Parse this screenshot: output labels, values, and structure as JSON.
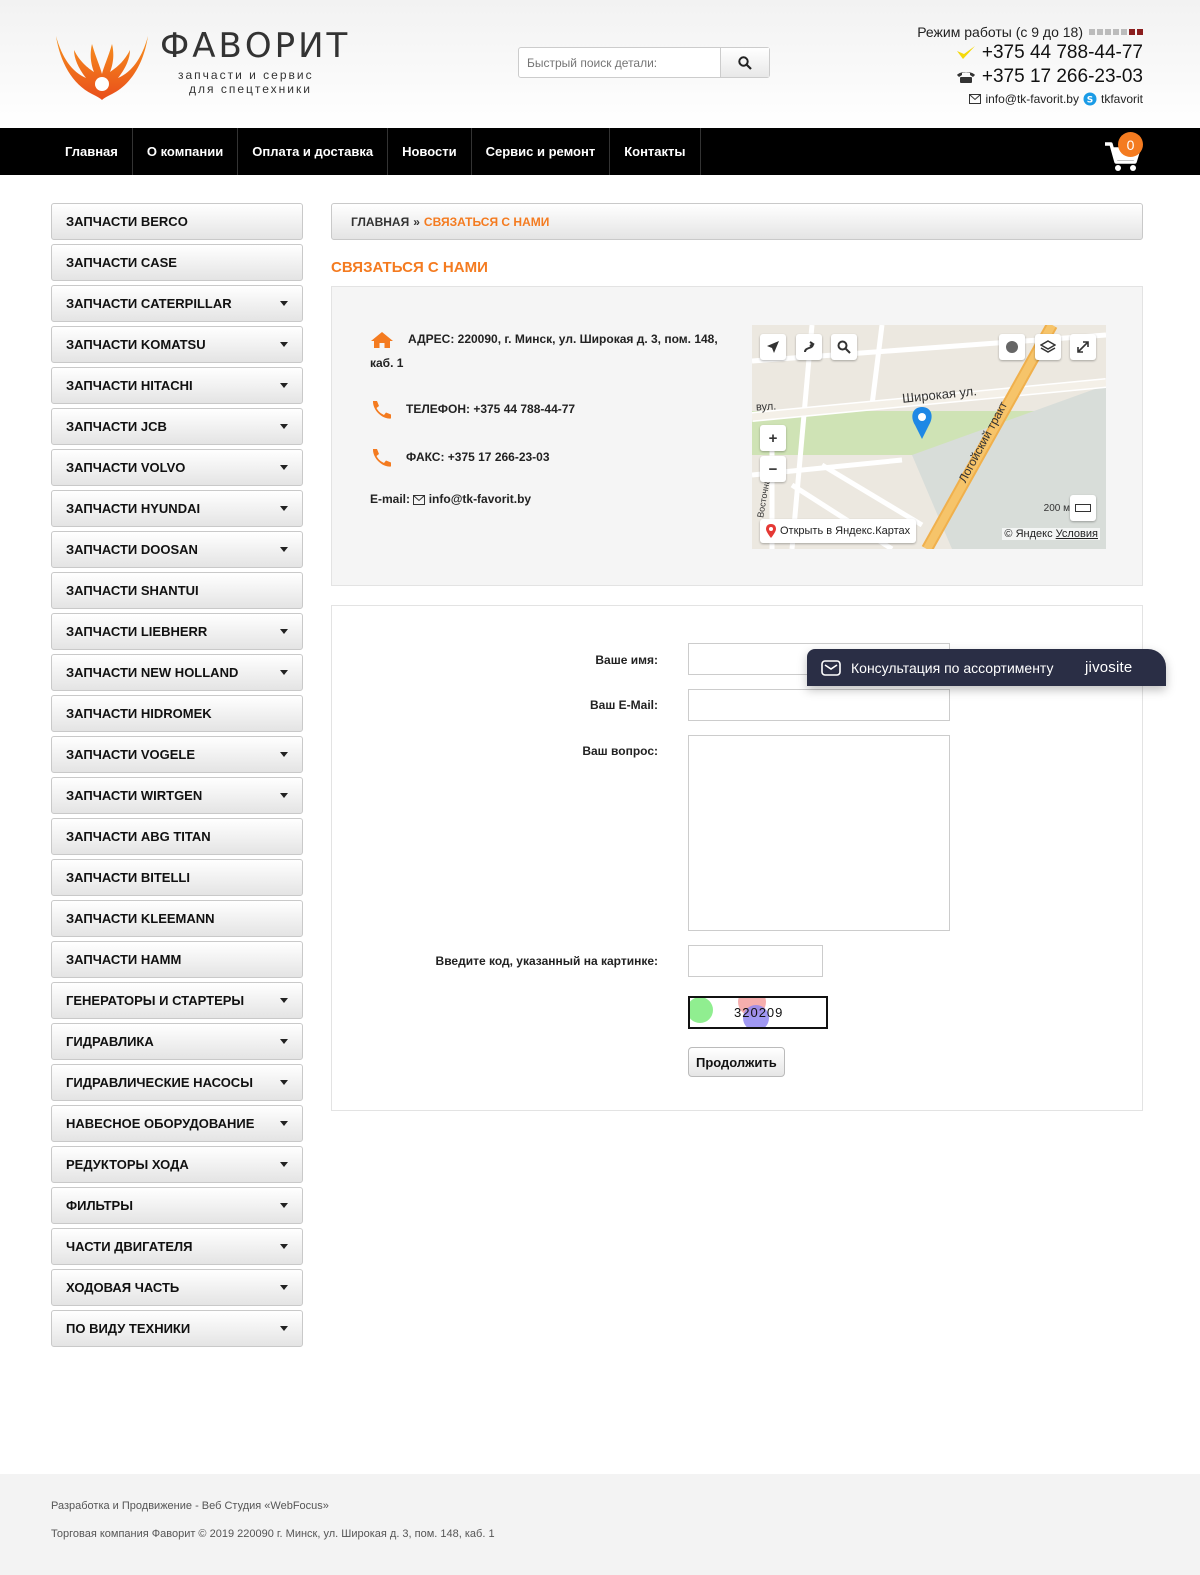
{
  "header": {
    "logo_name": "ФАВОРИТ",
    "logo_sub1": "запчасти и сервис",
    "logo_sub2": "для спецтехники",
    "search_placeholder": "Быстрый поиск детали:",
    "hours": "Режим работы (с 9 до 18)",
    "phone1": "+375 44 788-44-77",
    "phone2": "+375 17 266-23-03",
    "email": "info@tk-favorit.by",
    "skype": "tkfavorit"
  },
  "nav": {
    "items": [
      "Главная",
      "О компании",
      "Оплата и доставка",
      "Новости",
      "Сервис и ремонт",
      "Контакты"
    ],
    "cart_count": "0"
  },
  "sidebar": {
    "items": [
      {
        "label": "ЗАПЧАСТИ BERCO",
        "has_sub": false
      },
      {
        "label": "ЗАПЧАСТИ CASE",
        "has_sub": false
      },
      {
        "label": "ЗАПЧАСТИ CATERPILLAR",
        "has_sub": true
      },
      {
        "label": "ЗАПЧАСТИ KOMATSU",
        "has_sub": true
      },
      {
        "label": "ЗАПЧАСТИ HITACHI",
        "has_sub": true
      },
      {
        "label": "ЗАПЧАСТИ JCB",
        "has_sub": true
      },
      {
        "label": "ЗАПЧАСТИ VOLVO",
        "has_sub": true
      },
      {
        "label": "ЗАПЧАСТИ HYUNDAI",
        "has_sub": true
      },
      {
        "label": "ЗАПЧАСТИ DOOSAN",
        "has_sub": true
      },
      {
        "label": "ЗАПЧАСТИ SHANTUI",
        "has_sub": false
      },
      {
        "label": "ЗАПЧАСТИ LIEBHERR",
        "has_sub": true
      },
      {
        "label": "ЗАПЧАСТИ NEW HOLLAND",
        "has_sub": true
      },
      {
        "label": "ЗАПЧАСТИ HIDROMEK",
        "has_sub": false
      },
      {
        "label": "ЗАПЧАСТИ VOGELE",
        "has_sub": true
      },
      {
        "label": "ЗАПЧАСТИ WIRTGEN",
        "has_sub": true
      },
      {
        "label": "ЗАПЧАСТИ ABG TITAN",
        "has_sub": false
      },
      {
        "label": "ЗАПЧАСТИ BITELLI",
        "has_sub": false
      },
      {
        "label": "ЗАПЧАСТИ KLEEMANN",
        "has_sub": false
      },
      {
        "label": "ЗАПЧАСТИ HAMM",
        "has_sub": false
      },
      {
        "label": "ГЕНЕРАТОРЫ И СТАРТЕРЫ",
        "has_sub": true
      },
      {
        "label": "ГИДРАВЛИКА",
        "has_sub": true
      },
      {
        "label": "ГИДРАВЛИЧЕСКИЕ НАСОСЫ",
        "has_sub": true
      },
      {
        "label": "НАВЕСНОЕ ОБОРУДОВАНИЕ",
        "has_sub": true
      },
      {
        "label": "РЕДУКТОРЫ ХОДА",
        "has_sub": true
      },
      {
        "label": "ФИЛЬТРЫ",
        "has_sub": true
      },
      {
        "label": "ЧАСТИ ДВИГАТЕЛЯ",
        "has_sub": true
      },
      {
        "label": "ХОДОВАЯ ЧАСТЬ",
        "has_sub": true
      },
      {
        "label": "ПО ВИДУ ТЕХНИКИ",
        "has_sub": true
      }
    ]
  },
  "breadcrumb": {
    "home": "ГЛАВНАЯ",
    "sep": "»",
    "current": "СВЯЗАТЬСЯ С НАМИ"
  },
  "page_title": "СВЯЗАТЬСЯ С НАМИ",
  "contact": {
    "address": "АДРЕС: 220090, г. Минск, ул. Широкая д. 3, пом. 148, каб. 1",
    "phone": "ТЕЛЕФОН: +375 44 788-44-77",
    "fax": "ФАКС: +375 17 266-23-03",
    "email_label": "E-mail:",
    "email": "info@tk-favorit.by"
  },
  "map": {
    "street1": "Широкая ул.",
    "street2": "Логойский тракт",
    "street3": "вул.",
    "street4": "Восточная",
    "open_label": "Открыть в Яндекс.Картах",
    "copyright": "© Яндекс",
    "terms": "Условия",
    "scale": "200 м"
  },
  "form": {
    "name_label": "Ваше имя:",
    "email_label": "Ваш E-Mail:",
    "question_label": "Ваш вопрос:",
    "captcha_label": "Введите код, указанный на картинке:",
    "captcha_code": "320209",
    "submit_label": "Продолжить"
  },
  "jivo": {
    "text": "Консультация по ассортименту",
    "brand": "jivosite"
  },
  "footer": {
    "line1": "Разработка и Продвижение - Веб Студия «WebFocus»",
    "line2": "Торговая компания Фаворит © 2019 220090 г. Минск, ул. Широкая д. 3, пом. 148, каб. 1"
  },
  "colors": {
    "accent": "#f47b20",
    "nav_bg": "#000000",
    "jivo_bg": "#2a2e45"
  }
}
